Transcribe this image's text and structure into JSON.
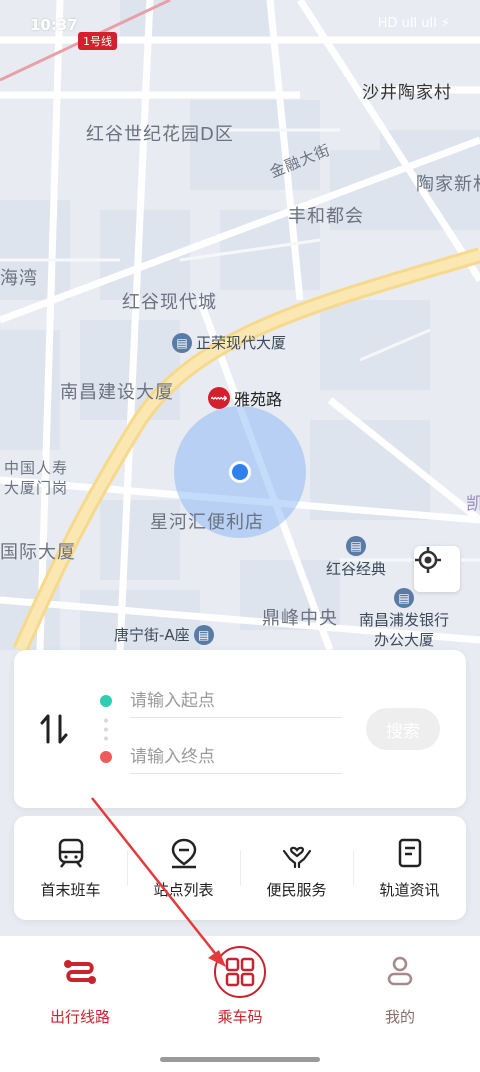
{
  "status_bar": {
    "time": "10:37",
    "icons": "HD ull ull ⚡"
  },
  "map": {
    "line_badge": "1号线",
    "labels": [
      {
        "text": "沙井陶家村"
      },
      {
        "text": "红谷世纪花园D区"
      },
      {
        "text": "金融大街"
      },
      {
        "text": "陶家新村"
      },
      {
        "text": "丰和都会"
      },
      {
        "text": "海湾"
      },
      {
        "text": "红谷现代城"
      },
      {
        "text": "南昌建设大厦"
      },
      {
        "text": "中国人寿大厦门岗"
      },
      {
        "text": "星河汇便利店"
      },
      {
        "text": "国际大厦"
      },
      {
        "text": "鼎峰中央"
      },
      {
        "text": "凯"
      }
    ],
    "pois": [
      {
        "text": "正荣现代大厦"
      },
      {
        "text": "红谷经典"
      },
      {
        "text": "南昌浦发银行办公大厦"
      },
      {
        "text": "唐宁街-A座"
      }
    ],
    "station": {
      "text": "雅苑路"
    }
  },
  "route": {
    "start_placeholder": "请输入起点",
    "end_placeholder": "请输入终点",
    "search_label": "搜索"
  },
  "services": [
    {
      "label": "首末班车",
      "icon": "subway-icon"
    },
    {
      "label": "站点列表",
      "icon": "station-pin-icon"
    },
    {
      "label": "便民服务",
      "icon": "heart-hands-icon"
    },
    {
      "label": "轨道资讯",
      "icon": "news-doc-icon"
    }
  ],
  "tabs": [
    {
      "label": "出行线路",
      "icon": "route-icon"
    },
    {
      "label": "乘车码",
      "icon": "qrcode-icon"
    },
    {
      "label": "我的",
      "icon": "user-icon"
    }
  ],
  "colors": {
    "accent": "#c8242f",
    "start_dot": "#2ccfb1",
    "end_dot": "#f05a5a"
  }
}
